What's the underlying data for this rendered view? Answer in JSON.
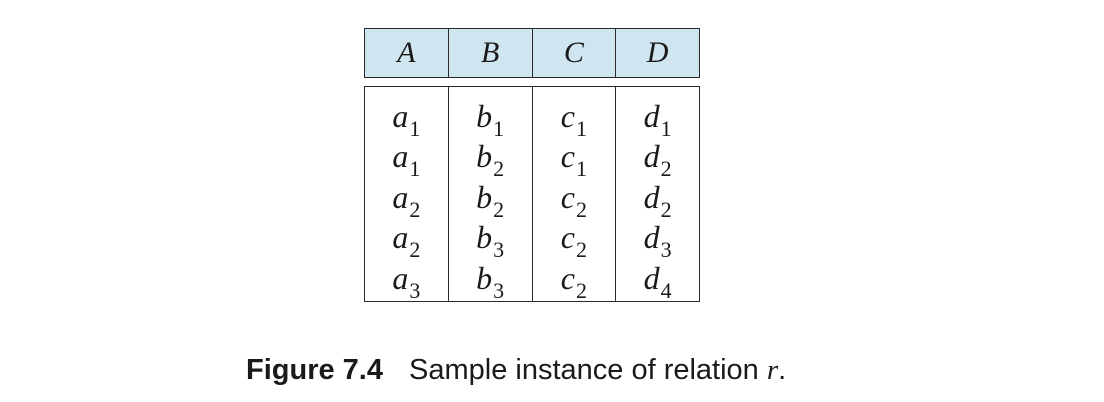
{
  "table": {
    "headers": [
      "A",
      "B",
      "C",
      "D"
    ],
    "rows": [
      [
        {
          "base": "a",
          "sub": "1"
        },
        {
          "base": "b",
          "sub": "1"
        },
        {
          "base": "c",
          "sub": "1"
        },
        {
          "base": "d",
          "sub": "1"
        }
      ],
      [
        {
          "base": "a",
          "sub": "1"
        },
        {
          "base": "b",
          "sub": "2"
        },
        {
          "base": "c",
          "sub": "1"
        },
        {
          "base": "d",
          "sub": "2"
        }
      ],
      [
        {
          "base": "a",
          "sub": "2"
        },
        {
          "base": "b",
          "sub": "2"
        },
        {
          "base": "c",
          "sub": "2"
        },
        {
          "base": "d",
          "sub": "2"
        }
      ],
      [
        {
          "base": "a",
          "sub": "2"
        },
        {
          "base": "b",
          "sub": "3"
        },
        {
          "base": "c",
          "sub": "2"
        },
        {
          "base": "d",
          "sub": "3"
        }
      ],
      [
        {
          "base": "a",
          "sub": "3"
        },
        {
          "base": "b",
          "sub": "3"
        },
        {
          "base": "c",
          "sub": "2"
        },
        {
          "base": "d",
          "sub": "4"
        }
      ]
    ],
    "header_color": "#cfe6f0"
  },
  "caption": {
    "label": "Figure 7.4",
    "text": "Sample instance of relation ",
    "relation": "r",
    "end": "."
  }
}
